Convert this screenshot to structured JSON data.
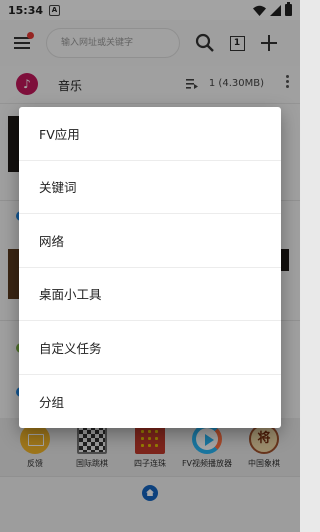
{
  "status_bar": {
    "time": "15:34",
    "notif_glyph": "A"
  },
  "top_bar": {
    "search_placeholder": "输入网址或关键字",
    "tab_count": "1"
  },
  "music": {
    "label": "音乐",
    "size": "1 (4.30MB)"
  },
  "apps": [
    {
      "label": "反馈",
      "icon": "feedback-icon"
    },
    {
      "label": "国际跳棋",
      "icon": "checkers-icon"
    },
    {
      "label": "四子连珠",
      "icon": "connect-four-icon"
    },
    {
      "label": "FV视频播放器",
      "icon": "video-player-icon"
    },
    {
      "label": "中国象棋",
      "icon": "xiangqi-icon",
      "glyph": "将"
    }
  ],
  "popup_menu": {
    "items": [
      "FV应用",
      "关键词",
      "网络",
      "桌面小工具",
      "自定义任务",
      "分组"
    ]
  }
}
